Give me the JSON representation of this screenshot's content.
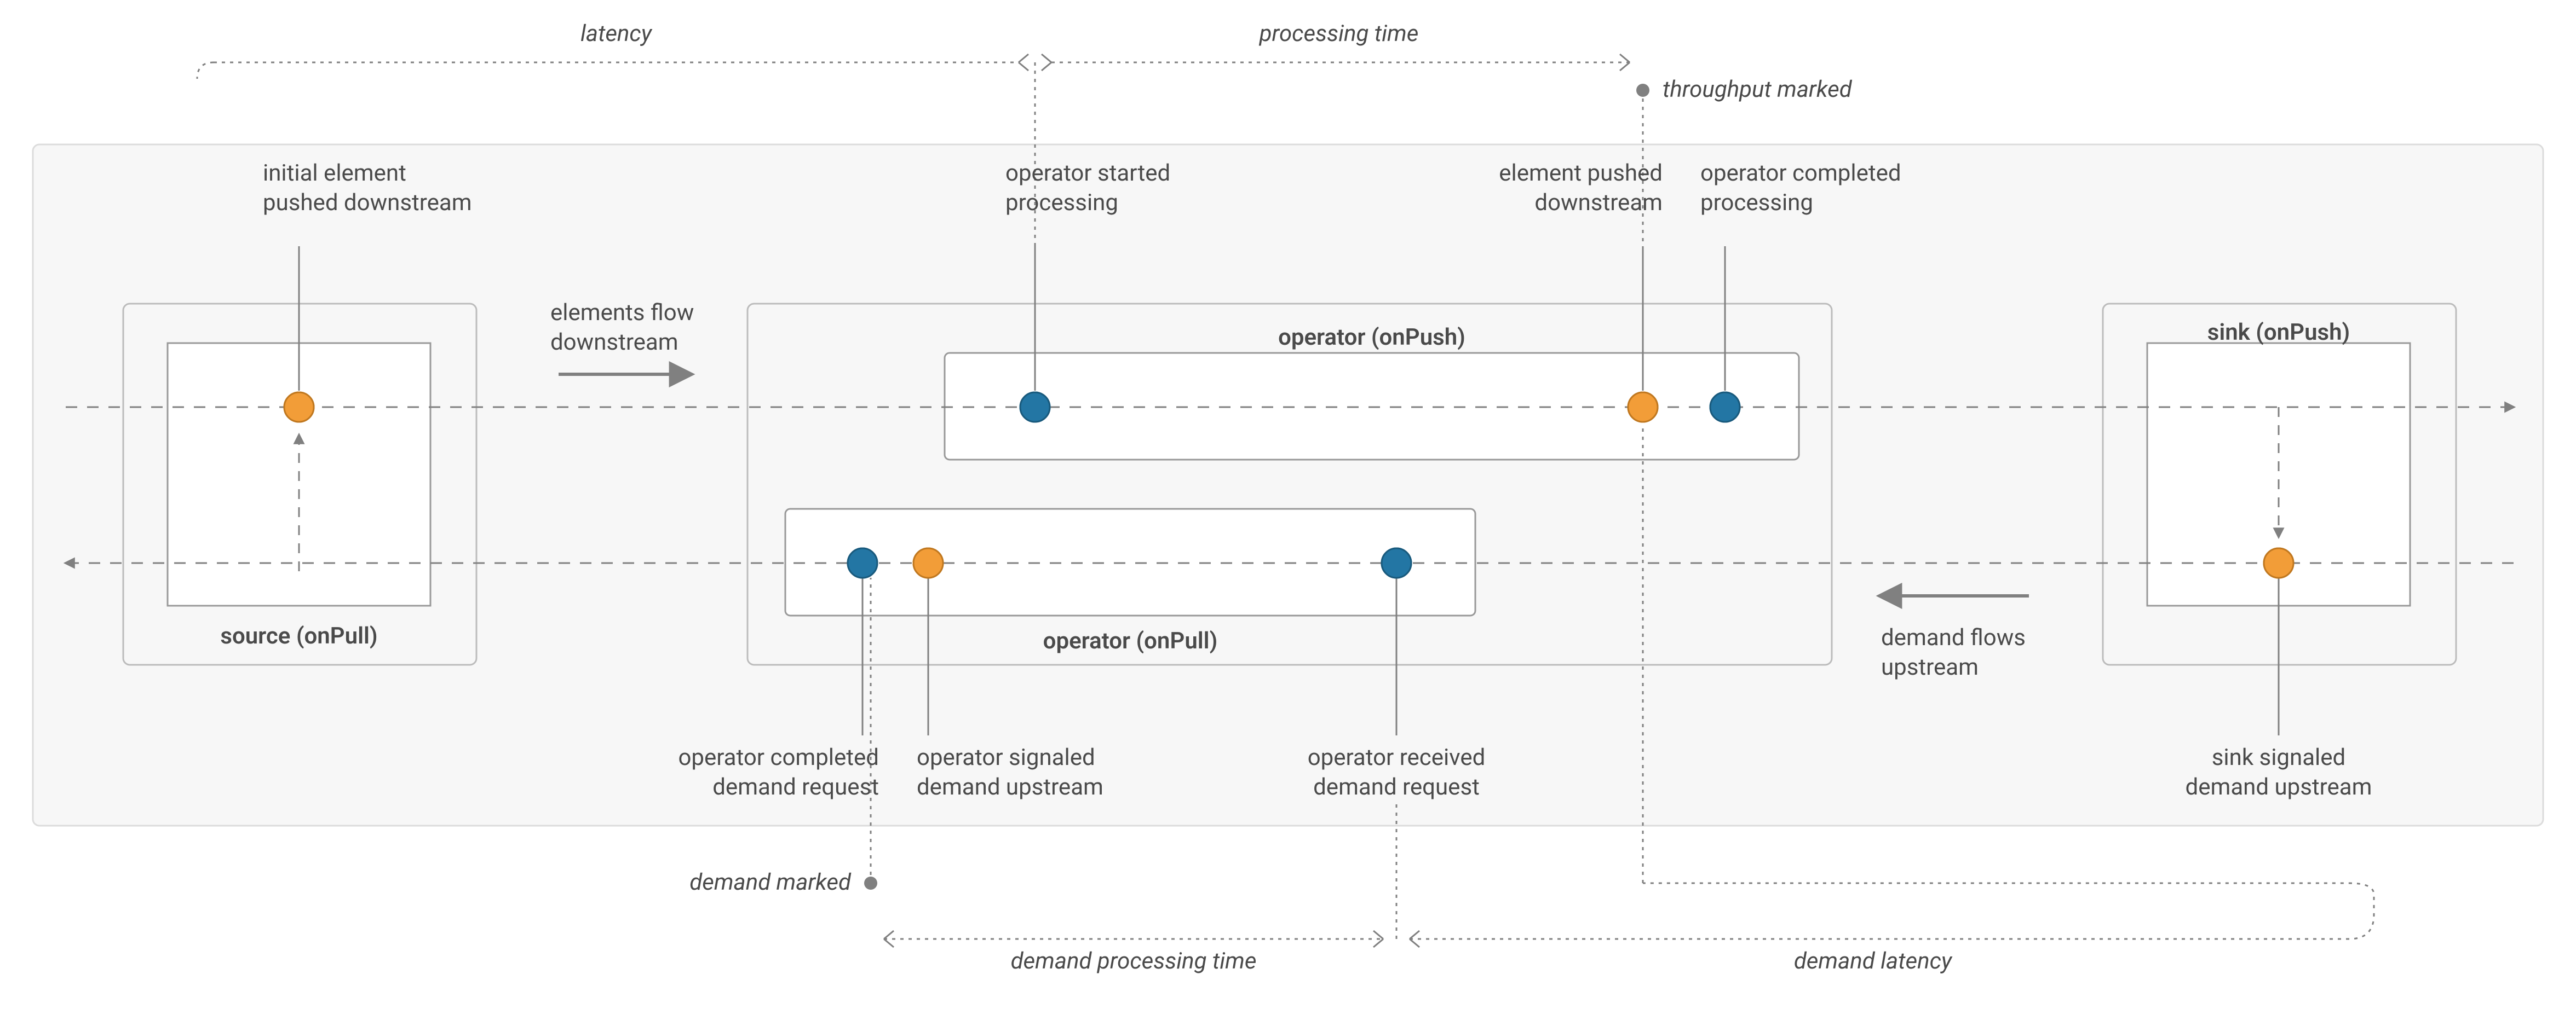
{
  "top": {
    "latency": "latency",
    "processing_time": "processing time",
    "throughput_marked": "throughput marked"
  },
  "bottom": {
    "demand_marked": "demand marked",
    "demand_processing_time": "demand processing time",
    "demand_latency": "demand latency"
  },
  "labels": {
    "initial_element_pushed": "initial element",
    "initial_element_pushed2": "pushed downstream",
    "operator_started_processing": "operator started",
    "operator_started_processing2": "processing",
    "element_pushed_downstream": "element pushed",
    "element_pushed_downstream2": "downstream",
    "operator_completed_processing": "operator completed",
    "operator_completed_processing2": "processing",
    "operator_completed_demand": "operator completed",
    "operator_completed_demand2": "demand request",
    "operator_signaled_demand": "operator signaled",
    "operator_signaled_demand2": "demand upstream",
    "operator_received_demand": "operator received",
    "operator_received_demand2": "demand request",
    "sink_signaled_demand": "sink signaled",
    "sink_signaled_demand2": "demand upstream",
    "elements_flow_downstream": "elements flow",
    "elements_flow_downstream2": "downstream",
    "demand_flows_upstream": "demand flows",
    "demand_flows_upstream2": "upstream"
  },
  "boxes": {
    "source": "source (onPull)",
    "operator_push": "operator (onPush)",
    "operator_pull": "operator (onPull)",
    "sink": "sink (onPush)"
  },
  "colors": {
    "orange": "#f29d38",
    "blue": "#2376a4",
    "grey_dot": "#808080",
    "box_fill": "#f7f7f7",
    "box_stroke": "#bcbcbc",
    "inner_stroke": "#999999",
    "dashed": "#808080",
    "dotted": "#808080"
  }
}
